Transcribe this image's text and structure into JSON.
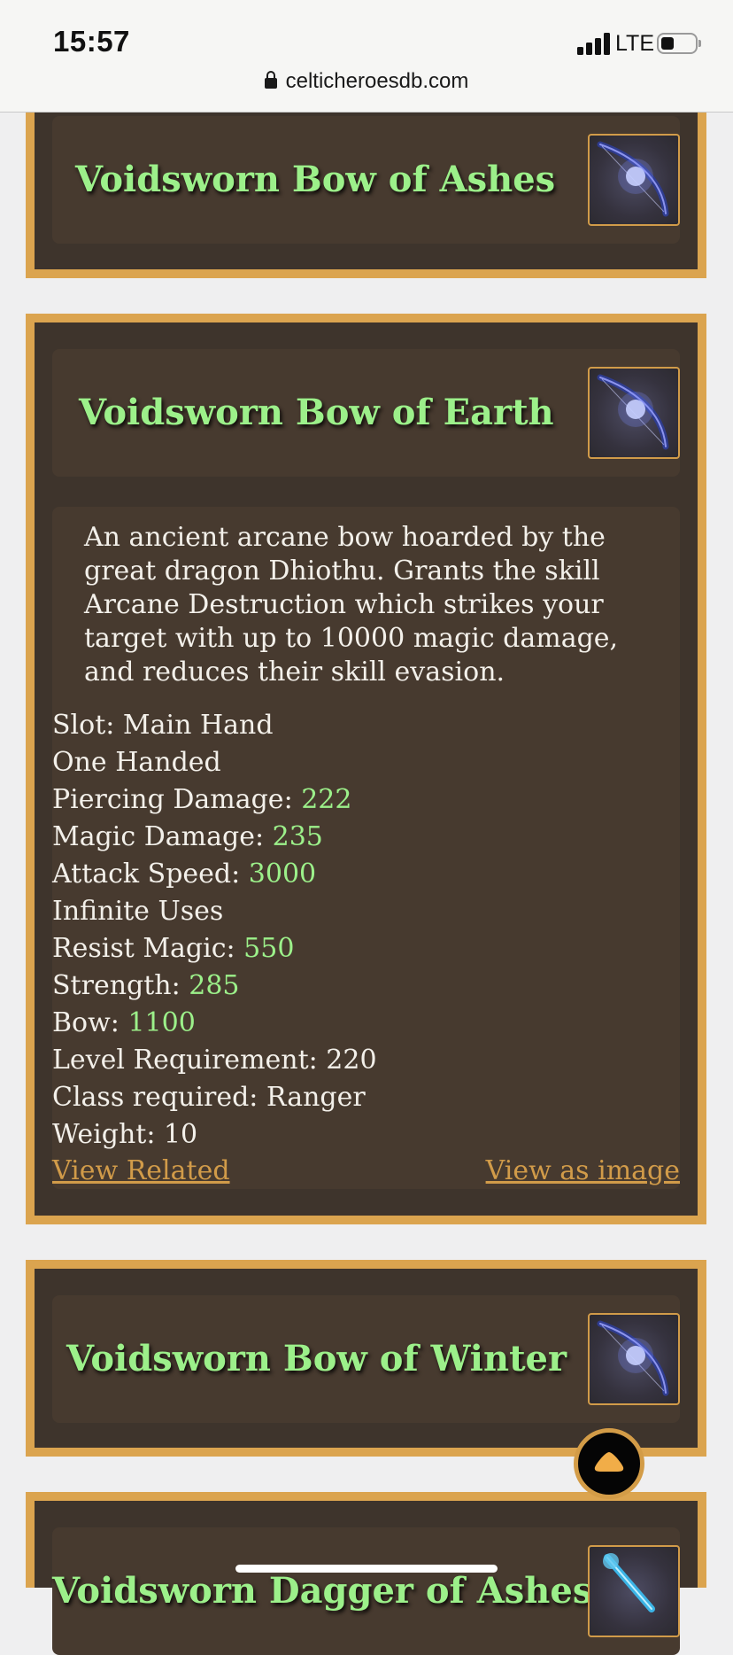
{
  "status_bar": {
    "time": "15:57",
    "network": "LTE"
  },
  "browser": {
    "url": "celticheroesdb.com"
  },
  "items": [
    {
      "title": "Voidsworn Bow of Ashes",
      "icon": "bow-icon"
    },
    {
      "title": "Voidsworn Bow of Earth",
      "icon": "bow-icon",
      "description": "An ancient arcane bow hoarded by the great dragon Dhiothu. Grants the skill Arcane Destruction which strikes your target with up to 10000 magic damage, and reduces their skill evasion.",
      "stats": [
        {
          "label": "Slot: Main Hand",
          "value": ""
        },
        {
          "label": "One Handed",
          "value": ""
        },
        {
          "label": "Piercing Damage: ",
          "value": "222"
        },
        {
          "label": "Magic Damage: ",
          "value": "235"
        },
        {
          "label": "Attack Speed: ",
          "value": "3000"
        },
        {
          "label": "Infinite Uses",
          "value": ""
        },
        {
          "label": "Resist Magic: ",
          "value": "550"
        },
        {
          "label": "Strength: ",
          "value": "285"
        },
        {
          "label": "Bow: ",
          "value": "1100"
        },
        {
          "label": "Level Requirement: 220",
          "value": ""
        },
        {
          "label": "Class required: Ranger",
          "value": ""
        },
        {
          "label": "Weight: 10",
          "value": ""
        }
      ],
      "links": {
        "view_related": "View Related",
        "view_as_image": "View as image"
      }
    },
    {
      "title": "Voidsworn Bow of Winter",
      "icon": "bow-icon"
    },
    {
      "title": "Voidsworn Dagger of Ashes",
      "icon": "dagger-icon"
    }
  ],
  "colors": {
    "card_border": "#dba44f",
    "card_bg": "#3e342c",
    "panel_bg": "#473a2f",
    "title_green": "#9cf08a",
    "link_gold": "#d19b49"
  },
  "scroll_top": {
    "icon": "chevron-up-icon"
  }
}
